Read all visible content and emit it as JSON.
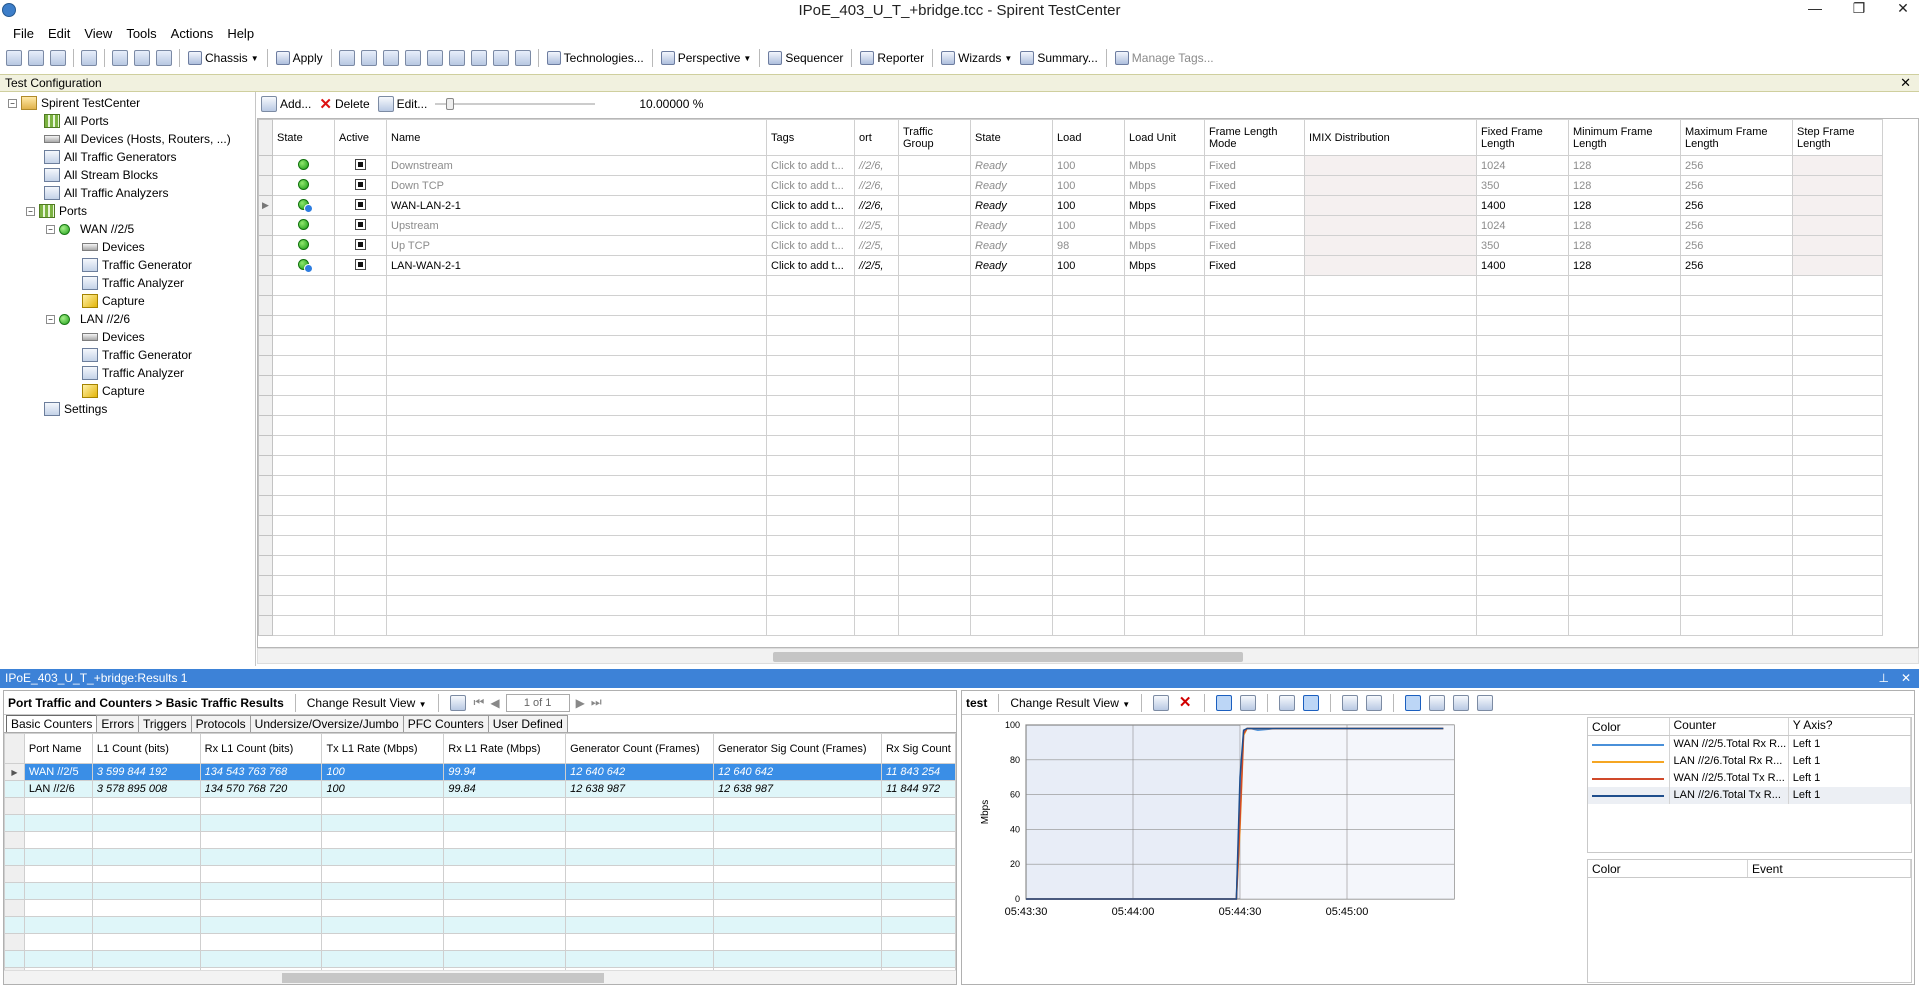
{
  "window": {
    "title": "IPoE_403_U_T_+bridge.tcc - Spirent TestCenter",
    "controls": [
      "—",
      "❐",
      "✕"
    ]
  },
  "menu": [
    "File",
    "Edit",
    "View",
    "Tools",
    "Actions",
    "Help"
  ],
  "toolbar": {
    "chassis": "Chassis",
    "apply": "Apply",
    "technologies": "Technologies...",
    "perspective": "Perspective",
    "sequencer": "Sequencer",
    "reporter": "Reporter",
    "wizards": "Wizards",
    "summary": "Summary...",
    "manage_tags": "Manage Tags..."
  },
  "config_panel": {
    "title": "Test Configuration"
  },
  "tree": [
    {
      "label": "Spirent TestCenter",
      "icon": "folder-icon"
    },
    {
      "label": "All Ports",
      "icon": "grid-icon"
    },
    {
      "label": "All Devices (Hosts, Routers, ...)",
      "icon": "device-icon"
    },
    {
      "label": "All Traffic Generators",
      "icon": "traffic-generator-icon"
    },
    {
      "label": "All Stream Blocks",
      "icon": "stream-block-icon"
    },
    {
      "label": "All Traffic Analyzers",
      "icon": "traffic-analyzer-icon"
    },
    {
      "label": "Ports",
      "icon": "grid-icon"
    },
    {
      "label": "WAN //2/5",
      "icon": "port-status-icon"
    },
    {
      "label": "Devices",
      "icon": "device-icon"
    },
    {
      "label": "Traffic Generator",
      "icon": "traffic-generator-icon"
    },
    {
      "label": "Traffic Analyzer",
      "icon": "traffic-analyzer-icon"
    },
    {
      "label": "Capture",
      "icon": "capture-icon"
    },
    {
      "label": "LAN //2/6",
      "icon": "port-status-icon"
    },
    {
      "label": "Devices",
      "icon": "device-icon"
    },
    {
      "label": "Traffic Generator",
      "icon": "traffic-generator-icon"
    },
    {
      "label": "Traffic Analyzer",
      "icon": "traffic-analyzer-icon"
    },
    {
      "label": "Capture",
      "icon": "capture-icon"
    },
    {
      "label": "Settings",
      "icon": "settings-icon"
    }
  ],
  "stream_toolbar": {
    "add": "Add...",
    "delete": "Delete",
    "edit": "Edit...",
    "load_percent": "10.00000 %",
    "slider_fraction": 0.07
  },
  "stream_table": {
    "headers": [
      "State",
      "Active",
      "Name",
      "Tags",
      "ort",
      "Traffic Group",
      "State",
      "Load",
      "Load Unit",
      "Frame Length Mode",
      "IMIX Distribution",
      "Fixed Frame Length",
      "Minimum Frame Length",
      "Maximum Frame Length",
      "Step Frame Length"
    ],
    "rows": [
      {
        "name": "Downstream",
        "tags": "Click to add t...",
        "port": "//2/6,",
        "group": "",
        "state": "Ready",
        "load": "100",
        "unit": "Mbps",
        "mode": "Fixed",
        "imix": "",
        "fixed": "1024",
        "min": "128",
        "max": "256",
        "step": "",
        "dim": true,
        "arrow": false
      },
      {
        "name": "Down TCP",
        "tags": "Click to add t...",
        "port": "//2/6,",
        "group": "",
        "state": "Ready",
        "load": "100",
        "unit": "Mbps",
        "mode": "Fixed",
        "imix": "",
        "fixed": "350",
        "min": "128",
        "max": "256",
        "step": "",
        "dim": true,
        "arrow": false
      },
      {
        "name": "WAN-LAN-2-1",
        "tags": "Click to add t...",
        "port": "//2/6,",
        "group": "",
        "state": "Ready",
        "load": "100",
        "unit": "Mbps",
        "mode": "Fixed",
        "imix": "",
        "fixed": "1400",
        "min": "128",
        "max": "256",
        "step": "",
        "dim": false,
        "arrow": true
      },
      {
        "name": "Upstream",
        "tags": "Click to add t...",
        "port": "//2/5,",
        "group": "",
        "state": "Ready",
        "load": "100",
        "unit": "Mbps",
        "mode": "Fixed",
        "imix": "",
        "fixed": "1024",
        "min": "128",
        "max": "256",
        "step": "",
        "dim": true,
        "arrow": false
      },
      {
        "name": "Up TCP",
        "tags": "Click to add t...",
        "port": "//2/5,",
        "group": "",
        "state": "Ready",
        "load": "98",
        "unit": "Mbps",
        "mode": "Fixed",
        "imix": "",
        "fixed": "350",
        "min": "128",
        "max": "256",
        "step": "",
        "dim": true,
        "arrow": false
      },
      {
        "name": "LAN-WAN-2-1",
        "tags": "Click to add t...",
        "port": "//2/5,",
        "group": "",
        "state": "Ready",
        "load": "100",
        "unit": "Mbps",
        "mode": "Fixed",
        "imix": "",
        "fixed": "1400",
        "min": "128",
        "max": "256",
        "step": "",
        "dim": false,
        "arrow": true
      }
    ]
  },
  "results": {
    "panel_title": "IPoE_403_U_T_+bridge:Results 1",
    "left": {
      "title": "Port Traffic and Counters > Basic Traffic Results",
      "change_view": "Change Result View",
      "pager": "1 of 1",
      "tabs": [
        "Basic Counters",
        "Errors",
        "Triggers",
        "Protocols",
        "Undersize/Oversize/Jumbo",
        "PFC Counters",
        "User Defined"
      ],
      "headers": [
        "Port Name",
        "L1 Count (bits)",
        "Rx L1 Count (bits)",
        "Tx L1 Rate (Mbps)",
        "Rx L1 Rate (Mbps)",
        "Generator Count (Frames)",
        "Generator Sig Count (Frames)",
        "Rx Sig Count"
      ],
      "rows": [
        [
          "WAN //2/5",
          "3 599 844 192",
          "134 543 763 768",
          "100",
          "99.94",
          "12 640 642",
          "12 640 642",
          "11 843 254"
        ],
        [
          "LAN //2/6",
          "3 578 895 008",
          "134 570 768 720",
          "100",
          "99.84",
          "12 638 987",
          "12 638 987",
          "11 844 972"
        ]
      ]
    },
    "chart_view": {
      "title": "test",
      "change_view": "Change Result View",
      "legend_headers": [
        "Color",
        "Counter",
        "Y Axis?"
      ],
      "legend_rows": [
        {
          "color": "#4a90d9",
          "counter": "WAN //2/5.Total Rx R...",
          "axis": "Left 1"
        },
        {
          "color": "#f5a623",
          "counter": "LAN //2/6.Total Rx R...",
          "axis": "Left 1"
        },
        {
          "color": "#d0492a",
          "counter": "WAN //2/5.Total Tx R...",
          "axis": "Left 1"
        },
        {
          "color": "#1f4e8c",
          "counter": "LAN //2/6.Total Tx R...",
          "axis": "Left 1"
        }
      ],
      "event_headers": [
        "Color",
        "Event"
      ]
    }
  },
  "chart_data": {
    "type": "line",
    "title": "",
    "xlabel": "",
    "ylabel": "Mbps",
    "x_ticks": [
      "05:43:30",
      "05:44:00",
      "05:44:30",
      "05:45:00"
    ],
    "y_ticks": [
      0,
      20,
      40,
      60,
      80,
      100
    ],
    "ylim": [
      0,
      100
    ],
    "xlim": [
      "05:43:30",
      "05:45:30"
    ],
    "grid": true,
    "x": [
      "05:43:30",
      "05:44:29",
      "05:44:30",
      "05:44:31",
      "05:44:32",
      "05:44:33",
      "05:44:35",
      "05:44:40",
      "05:45:00",
      "05:45:27"
    ],
    "series": [
      {
        "name": "WAN //2/5.Total Rx R...",
        "color": "#4a90d9",
        "values": [
          0,
          0,
          60,
          96,
          98,
          98,
          97,
          98,
          98,
          98
        ]
      },
      {
        "name": "LAN //2/6.Total Rx R...",
        "color": "#f5a623",
        "values": [
          0,
          0,
          40,
          94,
          98,
          98,
          98,
          98,
          98,
          98
        ]
      },
      {
        "name": "WAN //2/5.Total Tx R...",
        "color": "#d0492a",
        "values": [
          0,
          0,
          45,
          95,
          98,
          98,
          98,
          98,
          98,
          98
        ]
      },
      {
        "name": "LAN //2/6.Total Tx R...",
        "color": "#1f4e8c",
        "values": [
          0,
          0,
          70,
          97,
          98,
          98,
          98,
          98,
          98,
          98
        ]
      }
    ]
  }
}
